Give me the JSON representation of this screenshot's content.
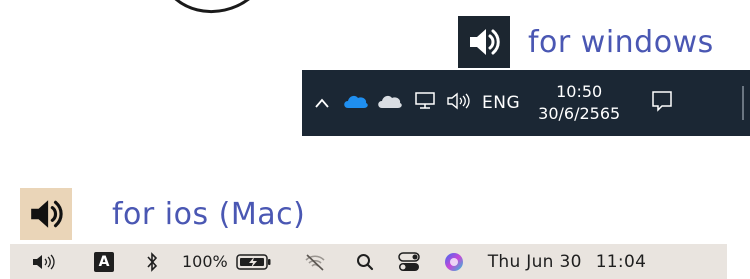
{
  "windows_section": {
    "heading": "for windows",
    "badge_icon": "speaker-icon",
    "taskbar": {
      "icons": [
        "chevron-up-icon",
        "onedrive-cloud-icon",
        "cloud-icon",
        "network-icon",
        "volume-icon",
        "notification-icon"
      ],
      "language": "ENG",
      "time": "10:50",
      "date": "30/6/2565"
    }
  },
  "mac_section": {
    "heading": "for ios (Mac)",
    "badge_icon": "speaker-icon",
    "menubar": {
      "icons": [
        "volume-icon",
        "input-source-icon",
        "bluetooth-icon",
        "battery-charging-icon",
        "wifi-off-icon",
        "search-icon",
        "control-center-icon",
        "siri-icon"
      ],
      "input_source": "A",
      "battery_percent": "100%",
      "date": "Thu Jun 30",
      "time": "11:04"
    }
  },
  "colors": {
    "heading": "#4a57b3",
    "windows_taskbar": "#1b2734",
    "windows_badge": "#1c2630",
    "mac_badge": "#ead5b8",
    "mac_menubar": "#e9e4df"
  }
}
